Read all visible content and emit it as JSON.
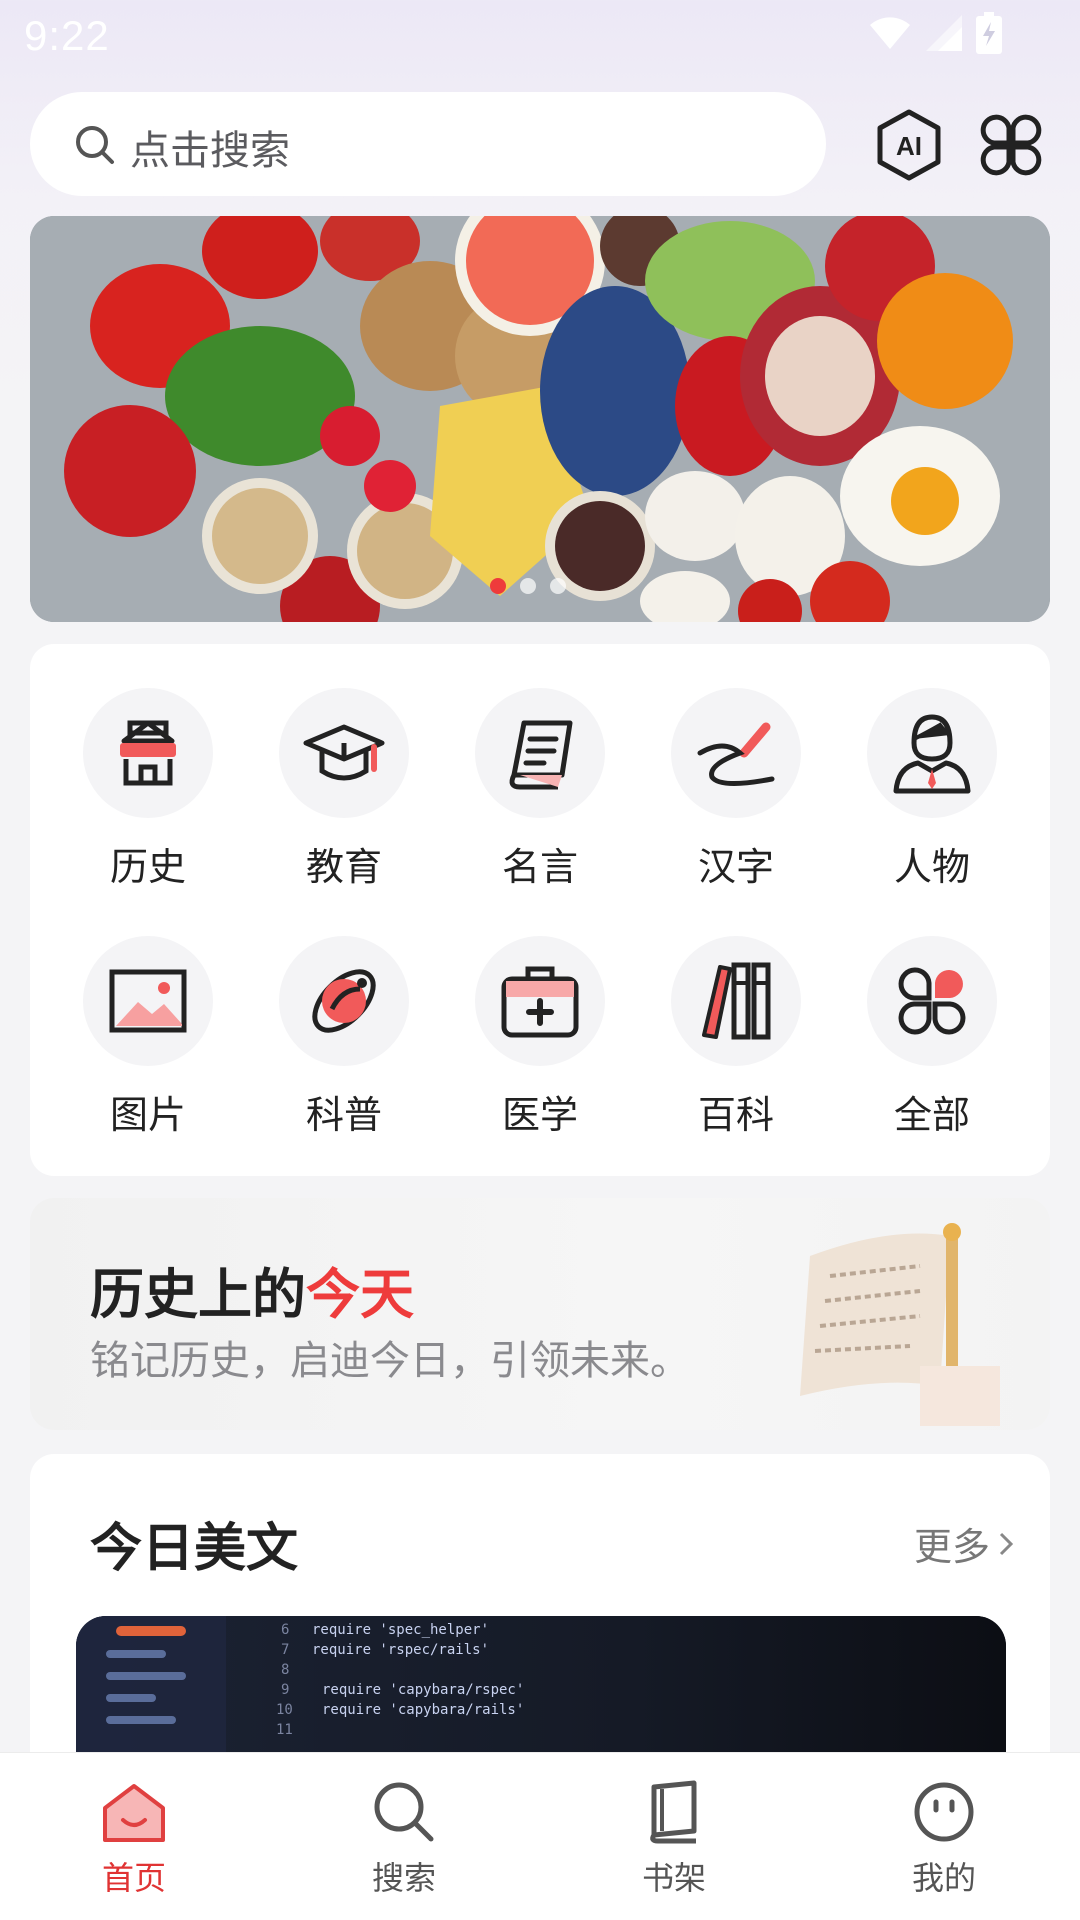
{
  "status_bar": {
    "time": "9:22"
  },
  "search": {
    "placeholder": "点击搜索"
  },
  "header_actions": {
    "ai_icon": "ai-hexagon-icon",
    "apps_icon": "four-petal-grid-icon"
  },
  "banner": {
    "slides": 3,
    "active_slide": 1
  },
  "categories": [
    {
      "label": "历史",
      "icon": "history-building-icon"
    },
    {
      "label": "教育",
      "icon": "graduation-cap-icon"
    },
    {
      "label": "名言",
      "icon": "scroll-document-icon"
    },
    {
      "label": "汉字",
      "icon": "pen-writing-icon"
    },
    {
      "label": "人物",
      "icon": "person-avatar-icon"
    },
    {
      "label": "图片",
      "icon": "image-icon"
    },
    {
      "label": "科普",
      "icon": "planet-science-icon"
    },
    {
      "label": "医学",
      "icon": "medical-kit-icon"
    },
    {
      "label": "百科",
      "icon": "books-icon"
    },
    {
      "label": "全部",
      "icon": "all-grid-icon"
    }
  ],
  "history_today": {
    "title_prefix": "历史上的",
    "title_accent": "今天",
    "subtitle": "铭记历史，启迪今日，引领未来。"
  },
  "article": {
    "title": "今日美文",
    "more": "更多"
  },
  "tabs": [
    {
      "label": "首页",
      "icon": "home-icon",
      "active": true
    },
    {
      "label": "搜索",
      "icon": "search-icon",
      "active": false
    },
    {
      "label": "书架",
      "icon": "book-icon",
      "active": false
    },
    {
      "label": "我的",
      "icon": "smiley-profile-icon",
      "active": false
    }
  ],
  "colors": {
    "accent": "#ee3b3b",
    "text": "#222222",
    "muted": "#8a8a8e"
  }
}
